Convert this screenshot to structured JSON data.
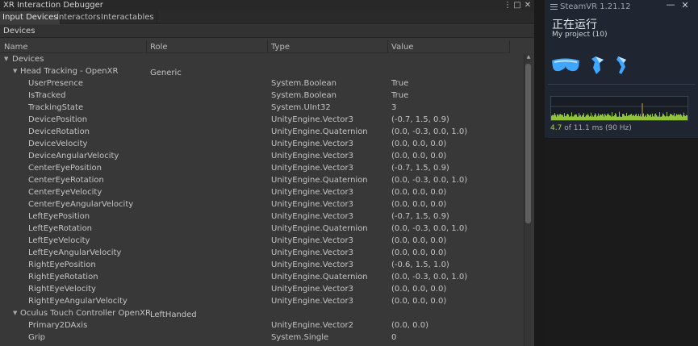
{
  "window": {
    "title": "XR Interaction Debugger",
    "tabs": [
      {
        "label": "Input Devices",
        "active": true
      },
      {
        "label": "Interactors",
        "active": false
      },
      {
        "label": "Interactables",
        "active": false
      }
    ],
    "section_label": "Devices",
    "columns": {
      "name": "Name",
      "role": "Role",
      "type": "Type",
      "value": "Value"
    }
  },
  "tree": [
    {
      "level": 0,
      "expanded": true,
      "name": "Devices",
      "role": "",
      "type": "",
      "value": ""
    },
    {
      "level": 1,
      "expanded": true,
      "name": "Head Tracking - OpenXR",
      "role": "Generic",
      "type": "",
      "value": ""
    },
    {
      "level": 2,
      "name": "UserPresence",
      "role": "",
      "type": "System.Boolean",
      "value": "True"
    },
    {
      "level": 2,
      "name": "IsTracked",
      "role": "",
      "type": "System.Boolean",
      "value": "True"
    },
    {
      "level": 2,
      "name": "TrackingState",
      "role": "",
      "type": "System.UInt32",
      "value": "3"
    },
    {
      "level": 2,
      "name": "DevicePosition",
      "role": "",
      "type": "UnityEngine.Vector3",
      "value": "(-0.7, 1.5, 0.9)"
    },
    {
      "level": 2,
      "name": "DeviceRotation",
      "role": "",
      "type": "UnityEngine.Quaternion",
      "value": "(0.0, -0.3, 0.0, 1.0)"
    },
    {
      "level": 2,
      "name": "DeviceVelocity",
      "role": "",
      "type": "UnityEngine.Vector3",
      "value": "(0.0, 0.0, 0.0)"
    },
    {
      "level": 2,
      "name": "DeviceAngularVelocity",
      "role": "",
      "type": "UnityEngine.Vector3",
      "value": "(0.0, 0.0, 0.0)"
    },
    {
      "level": 2,
      "name": "CenterEyePosition",
      "role": "",
      "type": "UnityEngine.Vector3",
      "value": "(-0.7, 1.5, 0.9)"
    },
    {
      "level": 2,
      "name": "CenterEyeRotation",
      "role": "",
      "type": "UnityEngine.Quaternion",
      "value": "(0.0, -0.3, 0.0, 1.0)"
    },
    {
      "level": 2,
      "name": "CenterEyeVelocity",
      "role": "",
      "type": "UnityEngine.Vector3",
      "value": "(0.0, 0.0, 0.0)"
    },
    {
      "level": 2,
      "name": "CenterEyeAngularVelocity",
      "role": "",
      "type": "UnityEngine.Vector3",
      "value": "(0.0, 0.0, 0.0)"
    },
    {
      "level": 2,
      "name": "LeftEyePosition",
      "role": "",
      "type": "UnityEngine.Vector3",
      "value": "(-0.7, 1.5, 0.9)"
    },
    {
      "level": 2,
      "name": "LeftEyeRotation",
      "role": "",
      "type": "UnityEngine.Quaternion",
      "value": "(0.0, -0.3, 0.0, 1.0)"
    },
    {
      "level": 2,
      "name": "LeftEyeVelocity",
      "role": "",
      "type": "UnityEngine.Vector3",
      "value": "(0.0, 0.0, 0.0)"
    },
    {
      "level": 2,
      "name": "LeftEyeAngularVelocity",
      "role": "",
      "type": "UnityEngine.Vector3",
      "value": "(0.0, 0.0, 0.0)"
    },
    {
      "level": 2,
      "name": "RightEyePosition",
      "role": "",
      "type": "UnityEngine.Vector3",
      "value": "(-0.6, 1.5, 1.0)"
    },
    {
      "level": 2,
      "name": "RightEyeRotation",
      "role": "",
      "type": "UnityEngine.Quaternion",
      "value": "(0.0, -0.3, 0.0, 1.0)"
    },
    {
      "level": 2,
      "name": "RightEyeVelocity",
      "role": "",
      "type": "UnityEngine.Vector3",
      "value": "(0.0, 0.0, 0.0)"
    },
    {
      "level": 2,
      "name": "RightEyeAngularVelocity",
      "role": "",
      "type": "UnityEngine.Vector3",
      "value": "(0.0, 0.0, 0.0)"
    },
    {
      "level": 1,
      "expanded": true,
      "name": "Oculus Touch Controller OpenXR",
      "role": "LeftHanded",
      "type": "",
      "value": ""
    },
    {
      "level": 2,
      "name": "Primary2DAxis",
      "role": "",
      "type": "UnityEngine.Vector2",
      "value": "(0.0, 0.0)"
    },
    {
      "level": 2,
      "name": "Grip",
      "role": "",
      "type": "System.Single",
      "value": "0"
    }
  ],
  "steamvr": {
    "title": "SteamVR 1.21.12",
    "status": "正在运行",
    "project": "My project (10)",
    "devices": [
      "headset-icon",
      "left-controller-icon",
      "right-controller-icon"
    ],
    "frame_time_ms": "4.7",
    "frame_budget_text": "of 11.1 ms (90 Hz)",
    "colors": {
      "device": "#3fa7ff",
      "graph": "#8fc43a",
      "highlight": "#aed23c"
    }
  }
}
